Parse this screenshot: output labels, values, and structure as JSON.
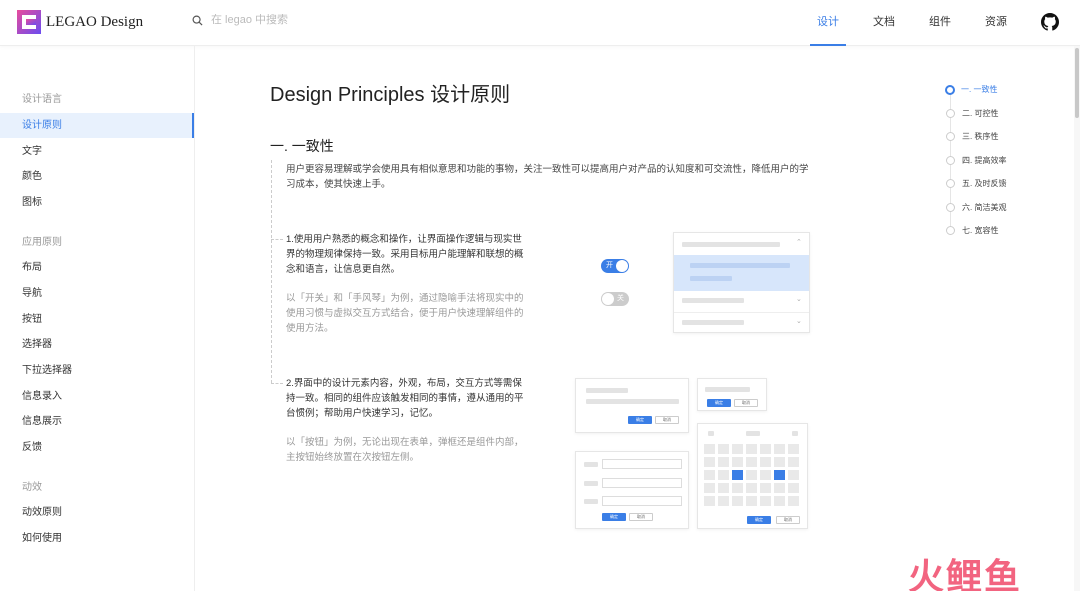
{
  "header": {
    "logo_text": "LEGAO Design",
    "search_placeholder": "在 legao 中搜索",
    "nav": [
      {
        "label": "设计",
        "active": true
      },
      {
        "label": "文档",
        "active": false
      },
      {
        "label": "组件",
        "active": false
      },
      {
        "label": "资源",
        "active": false
      }
    ],
    "github_icon": "github-icon",
    "accent_color": "#3a7ee6"
  },
  "sidebar": {
    "groups": [
      {
        "title": "设计语言",
        "items": [
          "设计原则",
          "文字",
          "颜色",
          "图标"
        ]
      },
      {
        "title": "应用原则",
        "items": [
          "布局",
          "导航",
          "按钮",
          "选择器",
          "下拉选择器",
          "信息录入",
          "信息展示",
          "反馈"
        ]
      },
      {
        "title": "动效",
        "items": [
          "动效原则",
          "如何使用"
        ]
      }
    ],
    "active_item": "设计原则"
  },
  "main": {
    "title": "Design Principles 设计原则",
    "section_title": "一. 一致性",
    "intro": "用户更容易理解或学会使用具有相似意思和功能的事物，关注一致性可以提高用户对产品的认知度和可交流性，降低用户的学习成本，使其快速上手。",
    "points": [
      {
        "main": "1.使用用户熟悉的概念和操作，让界面操作逻辑与现实世界的物理规律保持一致。采用目标用户能理解和联想的概念和语言，让信息更自然。",
        "sub": "以「开关」和「手风琴」为例，通过隐喻手法将现实中的使用习惯与虚拟交互方式结合，便于用户快速理解组件的使用方法。"
      },
      {
        "main": "2.界面中的设计元素内容，外观，布局，交互方式等需保持一致。相同的组件应该触发相同的事情，遵从通用的平台惯例；帮助用户快速学习，记忆。",
        "sub": "以「按钮」为例，无论出现在表单，弹框还是组件内部，主按钮始终放置在次按钮左侧。"
      }
    ],
    "illustration": {
      "toggle_on": "开",
      "toggle_off": "关",
      "primary_button": "确定",
      "secondary_button": "取消"
    }
  },
  "toc": {
    "items": [
      "一. 一致性",
      "二. 可控性",
      "三. 秩序性",
      "四. 提高效率",
      "五. 及时反馈",
      "六. 简洁美观",
      "七. 宽容性"
    ],
    "active_index": 0
  },
  "watermark": "火鲤鱼"
}
